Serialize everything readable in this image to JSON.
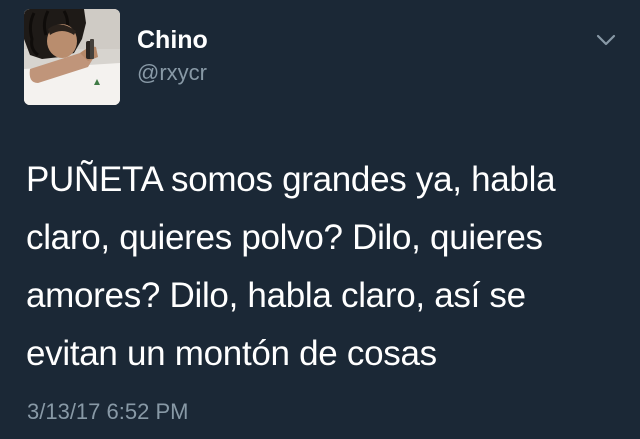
{
  "author": {
    "display_name": "Chino",
    "handle": "@rxycr"
  },
  "tweet": {
    "text_lines": [
      "PUÑETA somos grandes ya, habla",
      "claro, quieres polvo? Dilo, quieres",
      "amores? Dilo, habla claro, así se",
      "evitan un montón de cosas"
    ],
    "timestamp": "3/13/17 6:52 PM"
  },
  "icons": {
    "menu": "chevron-down-icon",
    "avatar": "profile-photo"
  },
  "colors": {
    "background": "#1b2836",
    "primary_text": "#ffffff",
    "secondary_text": "#8899a6"
  }
}
